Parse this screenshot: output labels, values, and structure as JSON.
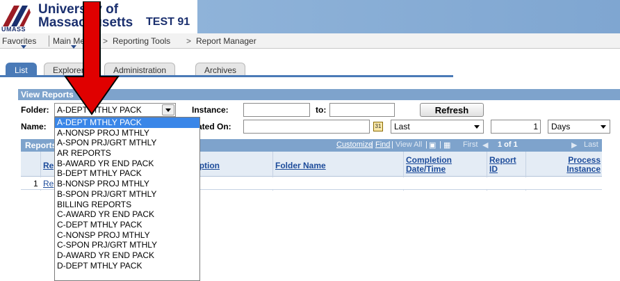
{
  "header": {
    "umass_logo": "UMASS",
    "university_line1": "University of",
    "university_line2": "Massachusetts",
    "env_label": "TEST 91"
  },
  "nav": {
    "favorites": "Favorites",
    "main_menu": "Main Menu",
    "sep": ">",
    "reporting_tools": "Reporting Tools",
    "report_manager": "Report Manager"
  },
  "tabs": [
    "List",
    "Explorer",
    "Administration",
    "Archives"
  ],
  "view_reports": {
    "title": "View Reports",
    "folder_label": "Folder:",
    "folder_value": "A-DEPT MTHLY PACK",
    "instance_label": "Instance:",
    "instance_value": "",
    "to_label": "to:",
    "to_value": "",
    "refresh_label": "Refresh",
    "name_label": "Name:",
    "created_on_label": "Created On:",
    "created_on_value": "",
    "period_value": "Last",
    "days_count": "1",
    "unit_value": "Days"
  },
  "grid": {
    "title": "Reports",
    "customize": "Customize",
    "find": "Find",
    "view_all": "View All",
    "first": "First",
    "range": "1 of 1",
    "last": "Last",
    "columns": {
      "report": "Report",
      "description": "Description",
      "folder_name": "Folder Name",
      "completion_1": "Completion",
      "completion_2": "Date/Time",
      "report_id_1": "Report",
      "report_id_2": "ID",
      "process_1": "Process",
      "process_2": "Instance"
    },
    "rows": [
      {
        "num": "1",
        "report": "Re"
      }
    ]
  },
  "folder_options": [
    "A-DEPT MTHLY PACK",
    "A-NONSP PROJ MTHLY",
    "A-SPON PRJ/GRT MTHLY",
    "AR REPORTS",
    "B-AWARD YR END PACK",
    "B-DEPT MTHLY PACK",
    "B-NONSP PROJ MTHLY",
    "B-SPON PRJ/GRT MTHLY",
    "BILLING REPORTS",
    "C-AWARD YR END PACK",
    "C-DEPT MTHLY PACK",
    "C-NONSP PROJ MTHLY",
    "C-SPON PRJ/GRT MTHLY",
    "D-AWARD YR END PACK",
    "D-DEPT MTHLY PACK"
  ],
  "colors": {
    "accent": "#4a7ab7",
    "section": "#7ea3cc",
    "selected": "#3a86e8",
    "annotation": "#e00000"
  }
}
